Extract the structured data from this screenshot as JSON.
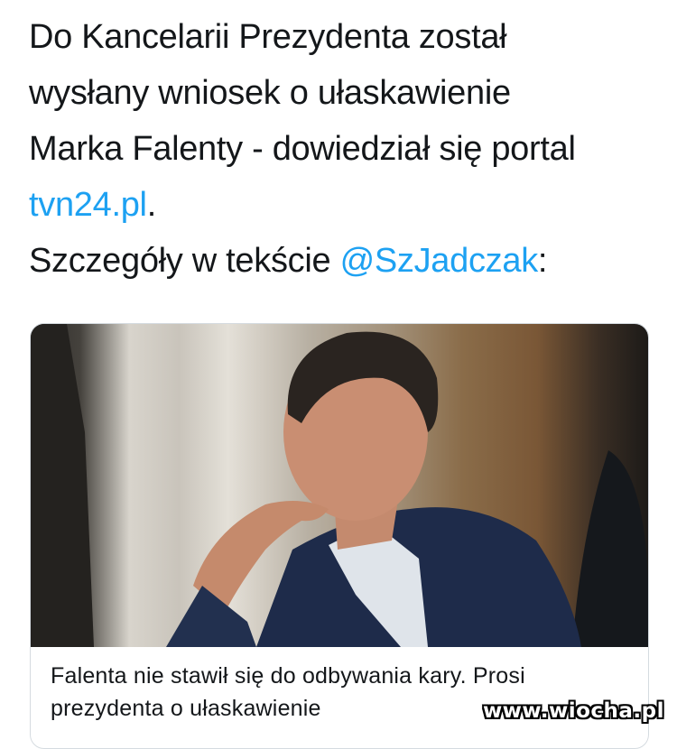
{
  "tweet": {
    "line1": "Do Kancelarii Prezydenta został",
    "line2": "wysłany wniosek o ułaskawienie",
    "line3": "Marka Falenty - dowiedział się portal",
    "link_portal": "tvn24.pl",
    "after_portal": ".",
    "details_prefix": "Szczegóły w tekście ",
    "mention": "@SzJadczak",
    "details_suffix": ":"
  },
  "card": {
    "image_icon": "photo-of-man-in-suit",
    "caption": "Falenta nie stawił się do odbywania kary. Prosi prezydenta o ułaskawienie"
  },
  "watermark": {
    "text": "www.wiocha.pl"
  },
  "colors": {
    "link": "#1da1f2",
    "text": "#14171a",
    "border": "#d5dbe0"
  }
}
